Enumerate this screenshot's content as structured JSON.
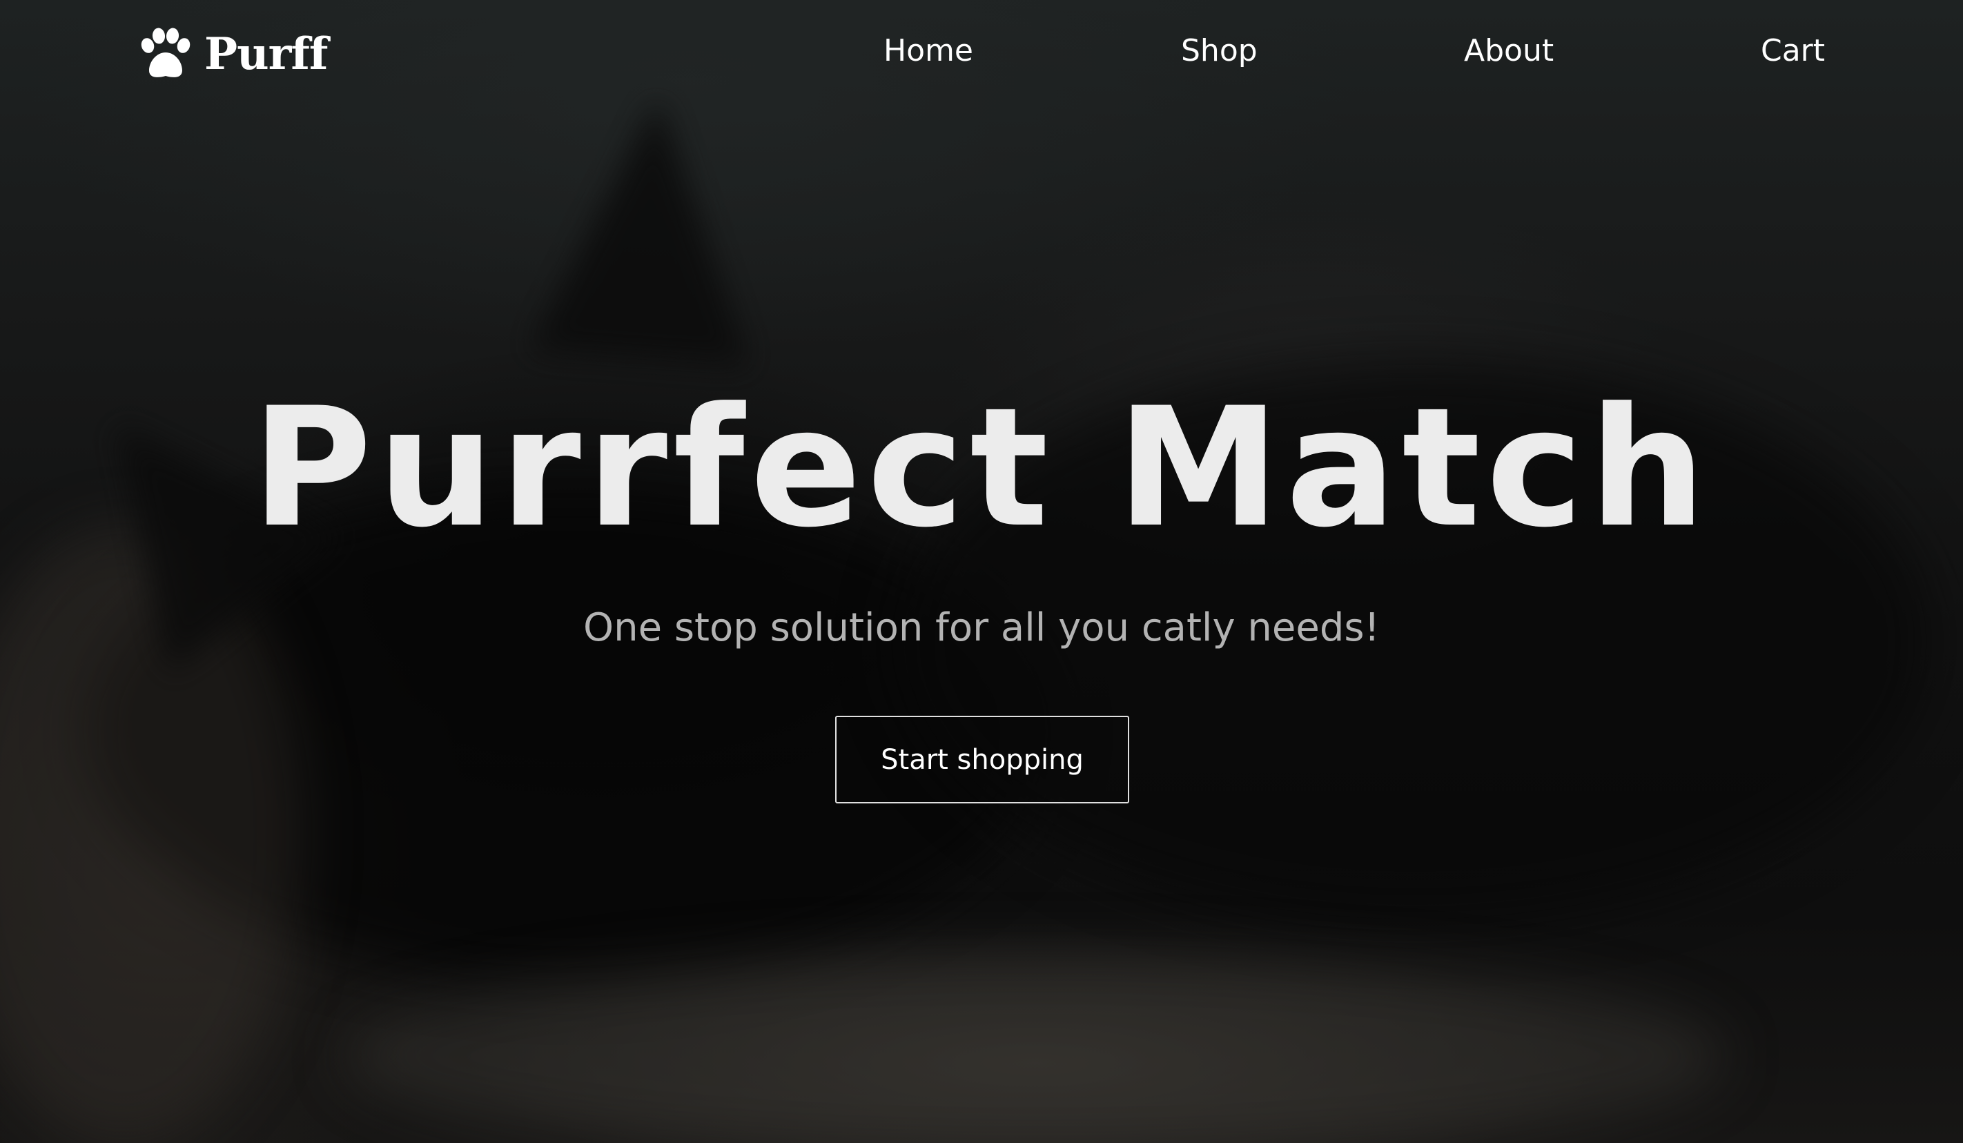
{
  "brand": {
    "name": "Purff",
    "icon": "paw-icon"
  },
  "nav": {
    "items": [
      {
        "label": "Home"
      },
      {
        "label": "Shop"
      },
      {
        "label": "About"
      },
      {
        "label": "Cart"
      }
    ]
  },
  "hero": {
    "title": "Purrfect Match",
    "subtitle": "One stop solution for all you catly needs!",
    "cta_label": "Start shopping",
    "background": "dark blurred photo of a black cat"
  },
  "colors": {
    "text_primary": "#ffffff",
    "title": "#ececec",
    "subtitle": "#b3b3b3",
    "background": "#111111"
  }
}
